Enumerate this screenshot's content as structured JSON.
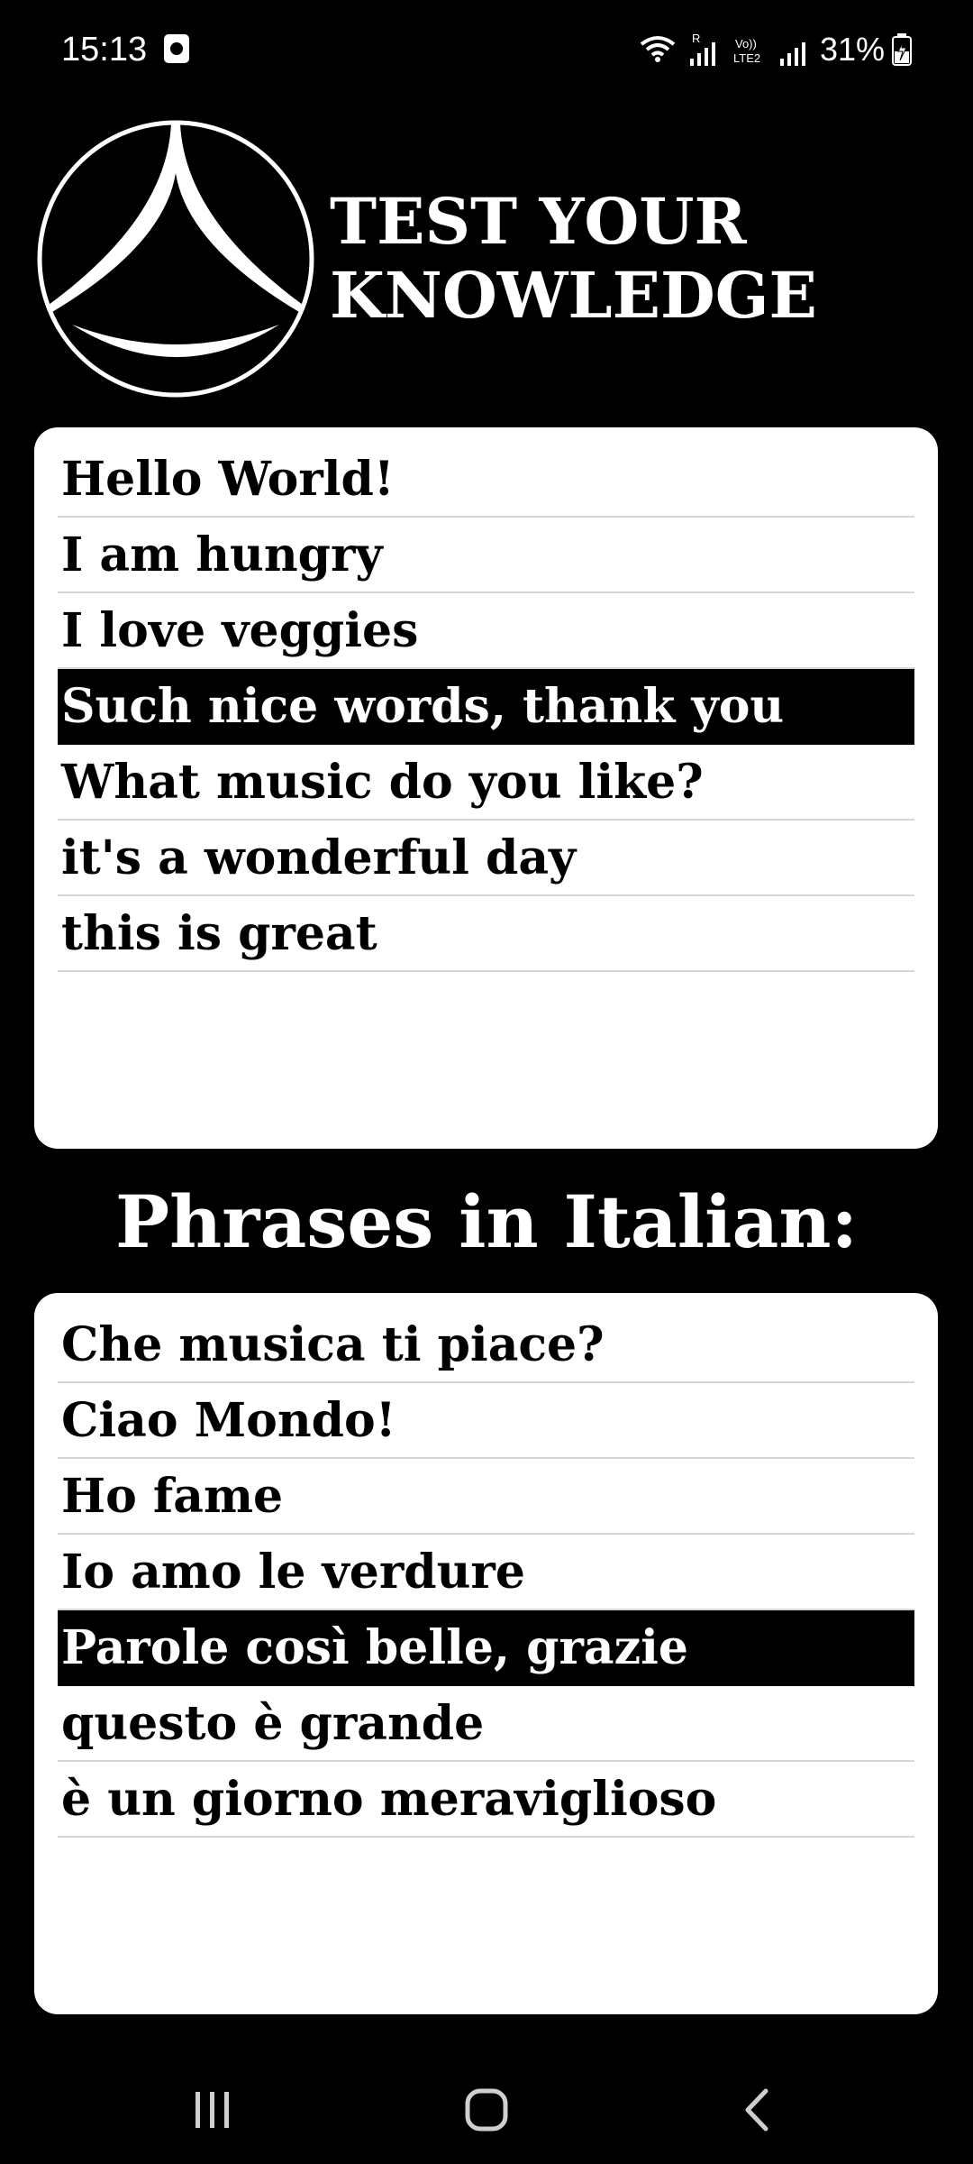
{
  "status_bar": {
    "time": "15:13",
    "battery": "31%",
    "network_labels": {
      "roaming": "R",
      "volte": "Vo)) LTE2"
    },
    "icons": [
      "app-notification-icon",
      "wifi-icon",
      "signal-icon",
      "battery-charging-icon"
    ]
  },
  "header": {
    "title_line1": "TEST YOUR",
    "title_line2": "KNOWLEDGE",
    "logo_icon": "logo-icon"
  },
  "english_list": {
    "items": [
      {
        "label": "Hello World!",
        "selected": false
      },
      {
        "label": "I am hungry",
        "selected": false
      },
      {
        "label": "I love veggies",
        "selected": false
      },
      {
        "label": "Such nice words, thank you",
        "selected": true
      },
      {
        "label": "What music do you like?",
        "selected": false
      },
      {
        "label": "it's a wonderful day",
        "selected": false
      },
      {
        "label": "this is great",
        "selected": false
      }
    ]
  },
  "section_heading": "Phrases in Italian:",
  "italian_list": {
    "items": [
      {
        "label": "Che musica ti piace?",
        "selected": false
      },
      {
        "label": "Ciao Mondo!",
        "selected": false
      },
      {
        "label": "Ho fame",
        "selected": false
      },
      {
        "label": "Io amo le verdure",
        "selected": false
      },
      {
        "label": "Parole così belle, grazie",
        "selected": true
      },
      {
        "label": "questo è grande",
        "selected": false
      },
      {
        "label": "è un giorno meraviglioso",
        "selected": false
      }
    ]
  },
  "nav_bar": {
    "icons": [
      "recent-apps-icon",
      "home-icon",
      "back-icon"
    ]
  },
  "colors": {
    "background": "#000000",
    "card": "#ffffff",
    "selected_row": "#000000",
    "divider": "#d6d6d6"
  }
}
